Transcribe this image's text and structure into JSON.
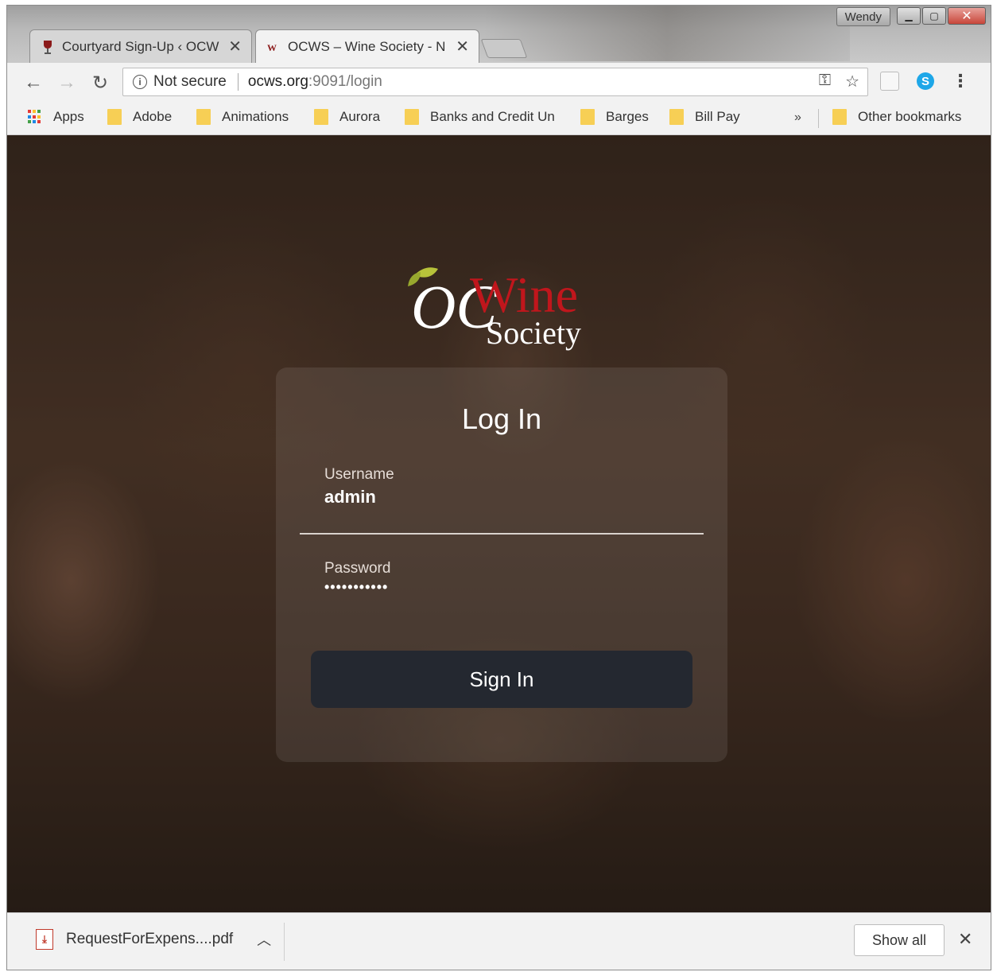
{
  "browser": {
    "user_badge": "Wendy",
    "tabs": [
      {
        "title": "Courtyard Sign-Up ‹ OCW",
        "active": false
      },
      {
        "title": "OCWS – Wine Society - N",
        "active": true
      }
    ],
    "security_label": "Not secure",
    "url_host": "ocws.org",
    "url_path": ":9091/login",
    "bookmarks": [
      {
        "label": "Apps",
        "icon": "apps-grid-icon"
      },
      {
        "label": "Adobe",
        "icon": "folder-icon"
      },
      {
        "label": "Animations",
        "icon": "folder-icon"
      },
      {
        "label": "Aurora",
        "icon": "folder-icon"
      },
      {
        "label": "Banks and Credit Un",
        "icon": "folder-icon"
      },
      {
        "label": "Barges",
        "icon": "folder-icon"
      },
      {
        "label": "Bill Pay",
        "icon": "folder-icon"
      }
    ],
    "overflow_label": "»",
    "other_bookmarks": "Other bookmarks"
  },
  "login": {
    "logo": {
      "script": "OC",
      "word": "Wine",
      "sub": "Society"
    },
    "title": "Log In",
    "username_label": "Username",
    "username_value": "admin",
    "password_label": "Password",
    "password_value": "•••••••••••",
    "submit_label": "Sign In"
  },
  "downloads": {
    "file": "RequestForExpens....pdf",
    "show_all": "Show all"
  },
  "colors": {
    "card_button": "#242830",
    "logo_red": "#c0161c",
    "folder": "#f7cf55"
  }
}
